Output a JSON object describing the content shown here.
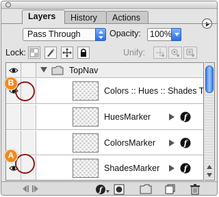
{
  "tabs": [
    {
      "label": "Layers",
      "active": true
    },
    {
      "label": "History",
      "active": false
    },
    {
      "label": "Actions",
      "active": false
    }
  ],
  "blend_mode": {
    "value": "Pass Through"
  },
  "opacity": {
    "label": "Opacity:",
    "value": "100%"
  },
  "lock": {
    "label": "Lock:"
  },
  "unify": {
    "label": "Unify:"
  },
  "layers": {
    "group": {
      "name": "TopNav",
      "visible": true,
      "expanded": true
    },
    "items": [
      {
        "name": "Colors :: Hues :: Shades Text",
        "visible": true,
        "type": "text",
        "has_effects": false
      },
      {
        "name": "HuesMarker",
        "visible": false,
        "type": "pixel",
        "has_effects": true
      },
      {
        "name": "ColorsMarker",
        "visible": false,
        "type": "pixel",
        "has_effects": true
      },
      {
        "name": "ShadesMarker",
        "visible": true,
        "type": "pixel",
        "has_effects": true
      }
    ]
  },
  "callouts": [
    {
      "label": "B"
    },
    {
      "label": "A"
    }
  ],
  "colors": {
    "accent": "#f08a1c",
    "ring": "#8b1a1a",
    "aqua": "#3b7be0"
  }
}
